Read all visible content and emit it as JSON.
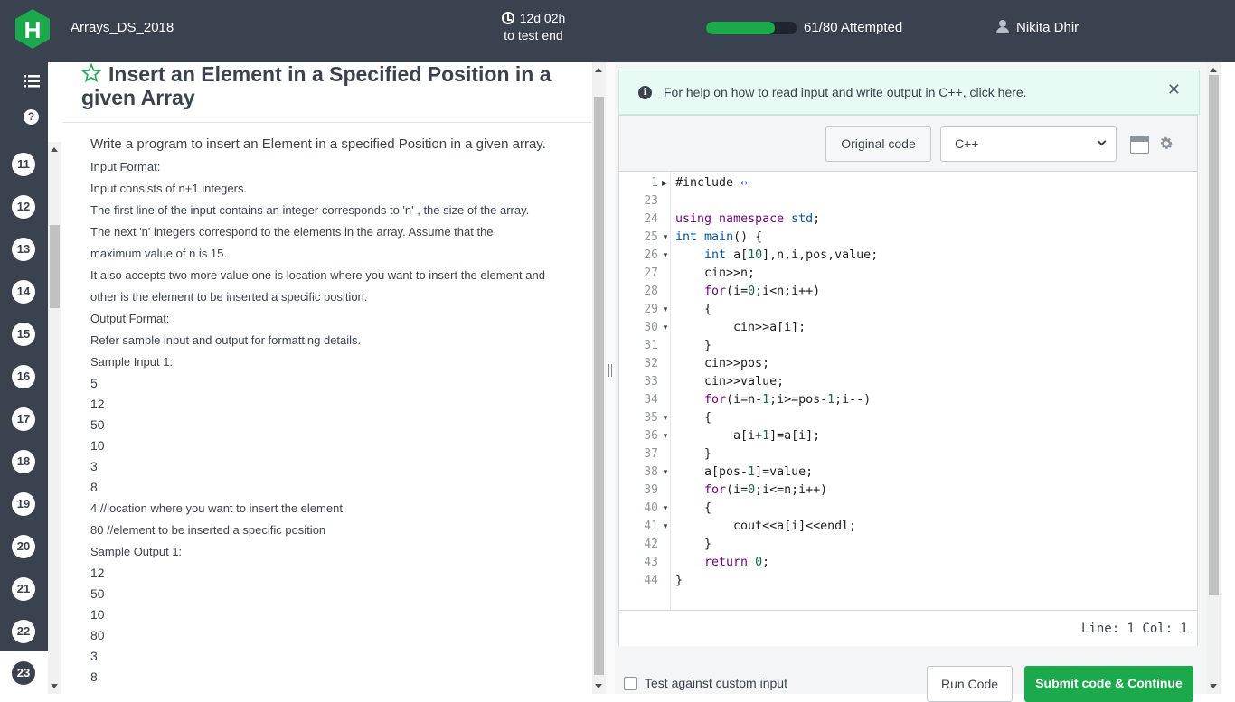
{
  "header": {
    "contest_name": "Arrays_DS_2018",
    "timer_value": "12d 02h",
    "timer_caption": "to test end",
    "progress_fraction": 0.76,
    "attempted": "61/80 Attempted",
    "user_name": "Nikita Dhir"
  },
  "rail": {
    "questions": [
      "11",
      "12",
      "13",
      "14",
      "15",
      "16",
      "17",
      "18",
      "19",
      "20",
      "21",
      "22",
      "23"
    ],
    "active": "23"
  },
  "problem": {
    "title": "Insert an Element in a Specified Position in a given Array",
    "lead": "Write a program to insert an Element in a specified Position in a given array.",
    "lines": [
      "Input Format:",
      "Input consists of n+1 integers.",
      "The first line of the input contains an integer corresponds to 'n' , the size of the array.",
      "The next 'n' integers correspond to the elements in the array. Assume that the",
      "maximum value of n is 15.",
      "It also accepts two more value one is location where you want to insert the element and",
      "other is the element to be inserted a specific position.",
      "Output Format:",
      "Refer  sample input and output for formatting details.",
      "Sample Input 1:"
    ],
    "sample_input": [
      "5",
      "12",
      "50",
      "10",
      "3",
      "8"
    ],
    "sample_notes": [
      "4 //location where you want to insert the element",
      "80 //element to be inserted a specific position",
      "Sample Output 1:"
    ],
    "sample_output": [
      "12",
      "50",
      "10",
      "80",
      "3",
      "8"
    ]
  },
  "editor": {
    "help_text": "For help on how to read input and write output in C++, click here.",
    "original_code_label": "Original code",
    "language": "C++",
    "line_numbers": [
      "1",
      "23",
      "24",
      "25",
      "26",
      "27",
      "28",
      "29",
      "30",
      "31",
      "32",
      "33",
      "34",
      "35",
      "36",
      "37",
      "38",
      "39",
      "40",
      "41",
      "42",
      "43",
      "44"
    ],
    "status": "Line: 1 Col: 1"
  },
  "bottom": {
    "custom_input_label": "Test against custom input",
    "run_label": "Run Code",
    "submit_label": "Submit code & Continue"
  },
  "colors": {
    "header_bg": "#39424e",
    "accent_green": "#1ba94c",
    "banner_bg": "#e8faf4"
  }
}
